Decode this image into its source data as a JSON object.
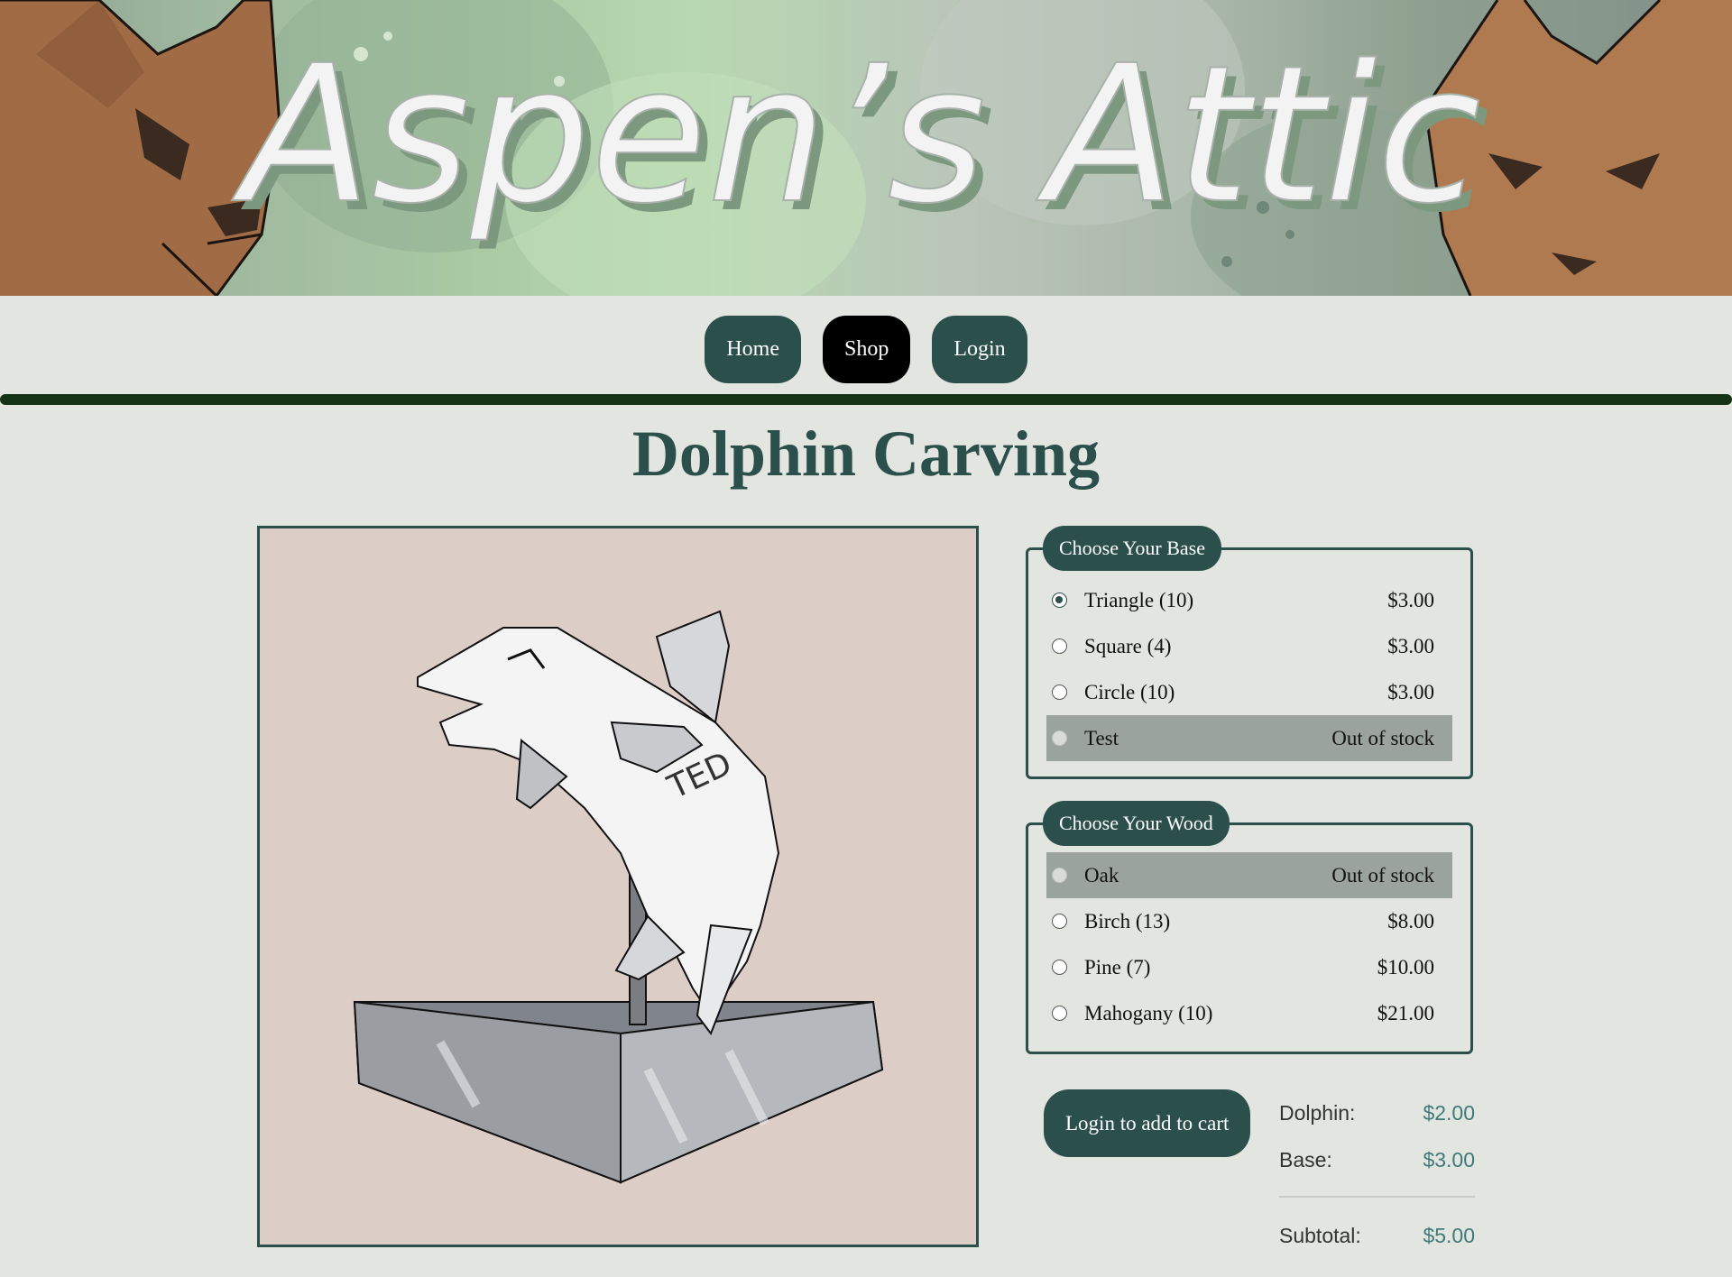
{
  "banner": {
    "title": "Aspen’s Attic"
  },
  "nav": {
    "home": "Home",
    "shop": "Shop",
    "login": "Login",
    "active": "shop"
  },
  "product": {
    "title": "Dolphin Carving",
    "watermark": "TED"
  },
  "base_group": {
    "legend": "Choose Your Base",
    "options": [
      {
        "label": "Triangle (10)",
        "price": "$3.00",
        "checked": true,
        "out_of_stock": false
      },
      {
        "label": "Square (4)",
        "price": "$3.00",
        "checked": false,
        "out_of_stock": false
      },
      {
        "label": "Circle (10)",
        "price": "$3.00",
        "checked": false,
        "out_of_stock": false
      },
      {
        "label": "Test",
        "price": "Out of stock",
        "checked": false,
        "out_of_stock": true
      }
    ]
  },
  "wood_group": {
    "legend": "Choose Your Wood",
    "options": [
      {
        "label": "Oak",
        "price": "Out of stock",
        "checked": false,
        "out_of_stock": true
      },
      {
        "label": "Birch (13)",
        "price": "$8.00",
        "checked": false,
        "out_of_stock": false
      },
      {
        "label": "Pine (7)",
        "price": "$10.00",
        "checked": false,
        "out_of_stock": false
      },
      {
        "label": "Mahogany (10)",
        "price": "$21.00",
        "checked": false,
        "out_of_stock": false
      }
    ]
  },
  "cart": {
    "button_label": "Login to add to cart",
    "dolphin_label": "Dolphin:",
    "dolphin_value": "$2.00",
    "base_label": "Base:",
    "base_value": "$3.00",
    "subtotal_label": "Subtotal:",
    "subtotal_value": "$5.00"
  },
  "colors": {
    "accent": "#2b4f4b",
    "nav_active": "#000000",
    "divider": "#163318",
    "background": "#e3e5e1",
    "out_of_stock_row": "#9aa49d",
    "price_text": "#3e7a78"
  }
}
